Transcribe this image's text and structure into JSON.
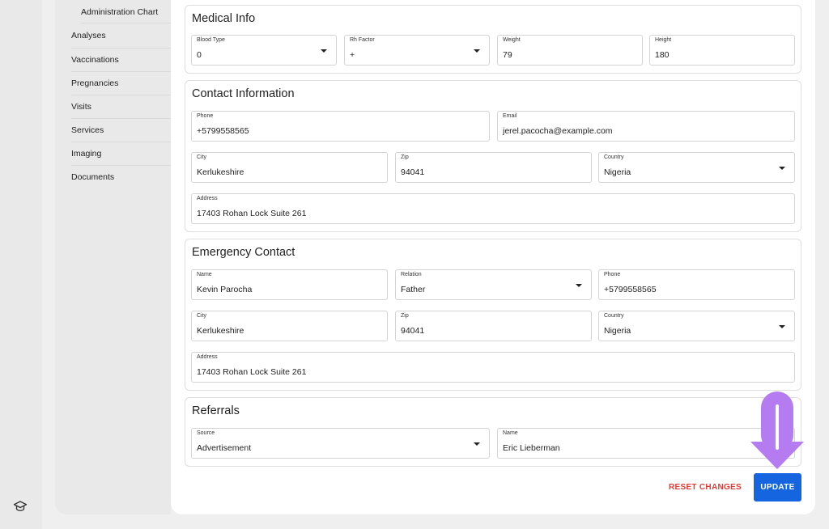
{
  "sidebar": {
    "sub_item": "Administration Chart",
    "items": [
      {
        "label": "Analyses"
      },
      {
        "label": "Vaccinations"
      },
      {
        "label": "Pregnancies"
      },
      {
        "label": "Visits"
      },
      {
        "label": "Services"
      },
      {
        "label": "Imaging"
      },
      {
        "label": "Documents"
      }
    ]
  },
  "rail": {
    "icon": "graduation-cap-icon"
  },
  "medical": {
    "title": "Medical Info",
    "blood_type": {
      "label": "Blood Type",
      "value": "0"
    },
    "rh_factor": {
      "label": "Rh Factor",
      "value": "+"
    },
    "weight": {
      "label": "Weight",
      "value": "79"
    },
    "height": {
      "label": "Height",
      "value": "180"
    }
  },
  "contact": {
    "title": "Contact Information",
    "phone": {
      "label": "Phone",
      "value": "+5799558565"
    },
    "email": {
      "label": "Email",
      "value": "jerel.pacocha@example.com"
    },
    "city": {
      "label": "City",
      "value": "Kerlukeshire"
    },
    "zip": {
      "label": "Zip",
      "value": "94041"
    },
    "country": {
      "label": "Country",
      "value": "Nigeria"
    },
    "address": {
      "label": "Address",
      "value": "17403 Rohan Lock Suite 261"
    }
  },
  "emergency": {
    "title": "Emergency Contact",
    "name": {
      "label": "Name",
      "value": "Kevin Parocha"
    },
    "relation": {
      "label": "Relation",
      "value": "Father"
    },
    "phone": {
      "label": "Phone",
      "value": "+5799558565"
    },
    "city": {
      "label": "City",
      "value": "Kerlukeshire"
    },
    "zip": {
      "label": "Zip",
      "value": "94041"
    },
    "country": {
      "label": "Country",
      "value": "Nigeria"
    },
    "address": {
      "label": "Address",
      "value": "17403 Rohan Lock Suite 261"
    }
  },
  "referrals": {
    "title": "Referrals",
    "source": {
      "label": "Source",
      "value": "Advertisement"
    },
    "name": {
      "label": "Name",
      "value": "Eric Lieberman"
    }
  },
  "actions": {
    "reset_label": "RESET CHANGES",
    "update_label": "UPDATE"
  },
  "colors": {
    "primary": "#1565e0",
    "danger": "#e53935",
    "highlight_arrow": "#b57bf0"
  }
}
